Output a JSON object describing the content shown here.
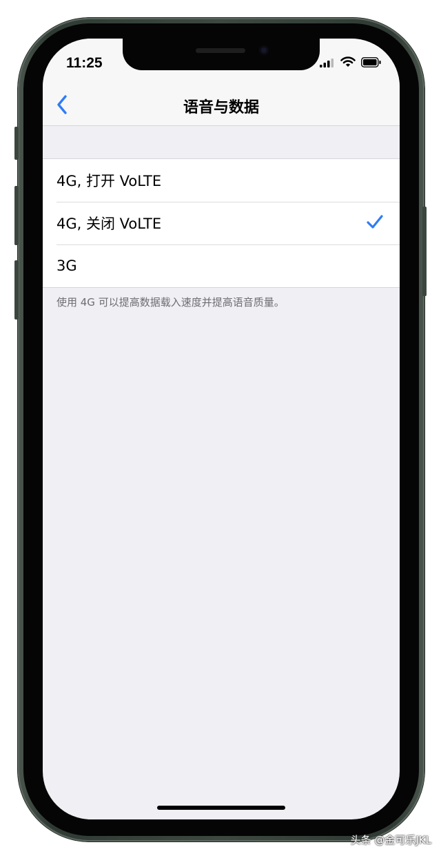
{
  "status_bar": {
    "time": "11:25"
  },
  "nav": {
    "title": "语音与数据"
  },
  "options": [
    {
      "label": "4G, 打开 VoLTE",
      "selected": false
    },
    {
      "label": "4G, 关闭 VoLTE",
      "selected": true
    },
    {
      "label": "3G",
      "selected": false
    }
  ],
  "footer_note": "使用 4G 可以提高数据载入速度并提高语音质量。",
  "watermark": "头条 @金可乐JKL",
  "colors": {
    "accent": "#2f7cf6",
    "background": "#efeff4",
    "frame": "#3c4840"
  },
  "icons": {
    "back": "chevron-left-icon",
    "check": "checkmark-icon",
    "signal": "cellular-signal-icon",
    "wifi": "wifi-icon",
    "battery": "battery-icon"
  }
}
